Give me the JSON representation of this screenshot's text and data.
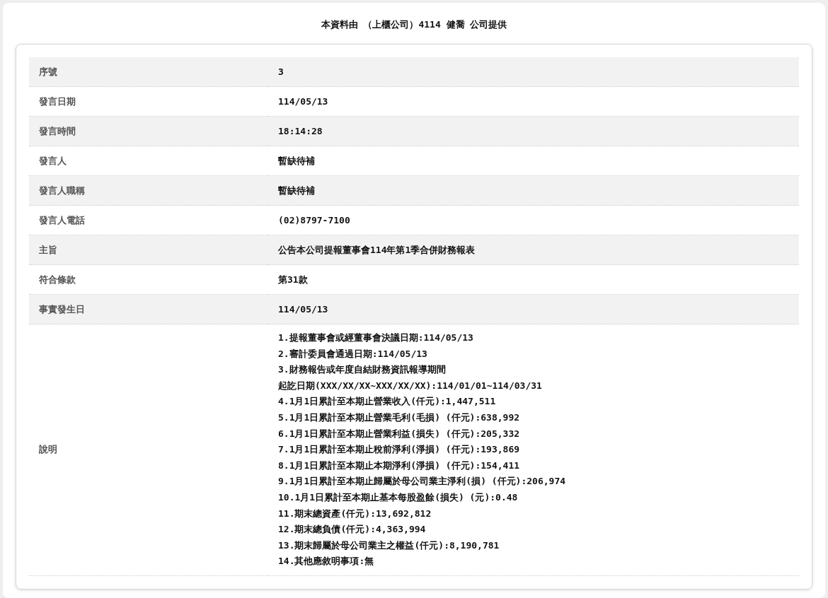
{
  "title": "本資料由 （上櫃公司）4114 健喬  公司提供",
  "rows": [
    {
      "kind": "text",
      "label": "序號",
      "value": "3"
    },
    {
      "kind": "text",
      "label": "發言日期",
      "value": "114/05/13"
    },
    {
      "kind": "text",
      "label": "發言時間",
      "value": "18:14:28"
    },
    {
      "kind": "text",
      "label": "發言人",
      "value": "暫缺待補"
    },
    {
      "kind": "text",
      "label": "發言人職稱",
      "value": "暫缺待補"
    },
    {
      "kind": "text",
      "label": "發言人電話",
      "value": "(02)8797-7100"
    },
    {
      "kind": "text",
      "label": "主旨",
      "value": "公告本公司提報董事會114年第1季合併財務報表"
    },
    {
      "kind": "text",
      "label": "符合條款",
      "value": "第31款"
    },
    {
      "kind": "text",
      "label": "事實發生日",
      "value": "114/05/13"
    },
    {
      "kind": "lines",
      "label": "說明",
      "lines": [
        "1.提報董事會或經董事會決議日期:114/05/13",
        "2.審計委員會通過日期:114/05/13",
        "3.財務報告或年度自結財務資訊報導期間",
        "起訖日期(XXX/XX/XX~XXX/XX/XX):114/01/01~114/03/31",
        "4.1月1日累計至本期止營業收入(仟元):1,447,511",
        "5.1月1日累計至本期止營業毛利(毛損) (仟元):638,992",
        "6.1月1日累計至本期止營業利益(損失) (仟元):205,332",
        "7.1月1日累計至本期止稅前淨利(淨損) (仟元):193,869",
        "8.1月1日累計至本期止本期淨利(淨損) (仟元):154,411",
        "9.1月1日累計至本期止歸屬於母公司業主淨利(損) (仟元):206,974",
        "10.1月1日累計至本期止基本每股盈餘(損失) (元):0.48",
        "11.期末總資產(仟元):13,692,812",
        "12.期末總負債(仟元):4,363,994",
        "13.期末歸屬於母公司業主之權益(仟元):8,190,781",
        "14.其他應敘明事項:無"
      ]
    }
  ]
}
